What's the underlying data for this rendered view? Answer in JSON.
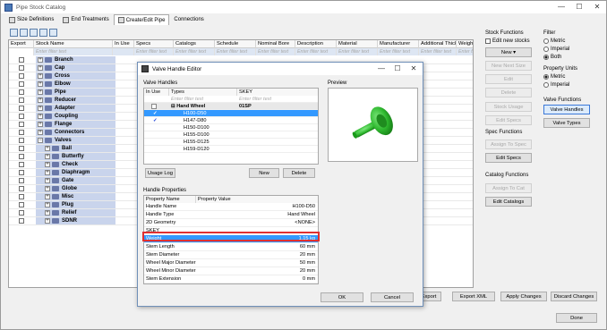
{
  "window": {
    "title": "Pipe Stock Catalog",
    "minimize": "—",
    "maximize": "☐",
    "close": "✕"
  },
  "tabs": [
    {
      "label": "Size Definitions"
    },
    {
      "label": "End Treatments"
    },
    {
      "label": "Create/Edit Pipe"
    },
    {
      "label": "Connections"
    }
  ],
  "grid": {
    "headers": [
      "Export",
      "Stock Name",
      "In Use",
      "Specs",
      "Catalogs",
      "Schedule",
      "Nominal Bore",
      "Description",
      "Material",
      "Manufacturer",
      "Additional Thickness",
      "Weight"
    ],
    "filter_placeholder": "Enter filter text",
    "rows": [
      {
        "label": "Branch"
      },
      {
        "label": "Cap"
      },
      {
        "label": "Cross"
      },
      {
        "label": "Elbow"
      },
      {
        "label": "Pipe"
      },
      {
        "label": "Reducer"
      },
      {
        "label": "Adapter"
      },
      {
        "label": "Coupling"
      },
      {
        "label": "Flange"
      },
      {
        "label": "Connectors"
      },
      {
        "label": "Valves"
      },
      {
        "label": "Ball"
      },
      {
        "label": "Butterfly"
      },
      {
        "label": "Check"
      },
      {
        "label": "Diaphragm"
      },
      {
        "label": "Gate"
      },
      {
        "label": "Globe"
      },
      {
        "label": "Misc"
      },
      {
        "label": "Plug"
      },
      {
        "label": "Relief"
      },
      {
        "label": "SDNR"
      }
    ]
  },
  "stock_functions": {
    "title": "Stock Functions",
    "edit_new_label": "Edit new stocks",
    "new_label": "New",
    "new_arrow": "▾",
    "buttons": [
      "New Next Size",
      "Edit",
      "Delete",
      "Stock Usage",
      "Edit Specs"
    ]
  },
  "spec_functions": {
    "title": "Spec Functions",
    "buttons": [
      "Assign To Spec",
      "Edit Specs"
    ]
  },
  "catalog_functions": {
    "title": "Catalog Functions",
    "buttons": [
      "Assign To Cat",
      "Edit Catalogs"
    ]
  },
  "filter": {
    "title": "Filter",
    "options": [
      "Metric",
      "Imperial",
      "Both"
    ],
    "selected": "Both"
  },
  "property_units": {
    "title": "Property Units",
    "options": [
      "Metric",
      "Imperial"
    ],
    "selected": "Metric"
  },
  "valve_functions": {
    "title": "Valve Functions",
    "buttons": [
      "Valve Handles",
      "Valve Types"
    ]
  },
  "bottom_buttons": [
    "Export",
    "Export XML",
    "Apply Changes",
    "Discard Changes",
    "Done"
  ],
  "dialog": {
    "title": "Valve Handle Editor",
    "valve_handles_title": "Valve Handles",
    "handles_headers": [
      "In Use",
      "Types",
      "SKEY"
    ],
    "filter_placeholder": "Enter filter text",
    "group": {
      "label": "Hand Wheel",
      "skey": "01SP"
    },
    "handles": [
      {
        "name": "H100-D50",
        "in_use": "✓"
      },
      {
        "name": "H147-D80",
        "in_use": "✓"
      },
      {
        "name": "H150-D100",
        "in_use": ""
      },
      {
        "name": "H155-D100",
        "in_use": ""
      },
      {
        "name": "H155-D125",
        "in_use": ""
      },
      {
        "name": "H159-D120",
        "in_use": ""
      }
    ],
    "usage_log_label": "Usage Log",
    "new_label": "New",
    "delete_label": "Delete",
    "preview_title": "Preview",
    "props_title": "Handle Properties",
    "props_headers": [
      "Property Name",
      "Property Value"
    ],
    "props": [
      {
        "name": "Handle Name",
        "value": "H100-D50"
      },
      {
        "name": "Handle Type",
        "value": "Hand Wheel"
      },
      {
        "name": "2D Geometry",
        "value": "<NONE>"
      },
      {
        "name": "SKEY",
        "value": ""
      },
      {
        "name": "Weight",
        "value": "1.15 kg"
      },
      {
        "name": "Stem Length",
        "value": "60 mm"
      },
      {
        "name": "Stem Diameter",
        "value": "20 mm"
      },
      {
        "name": "Wheel Major Diameter",
        "value": "50 mm"
      },
      {
        "name": "Wheel Minor Diameter",
        "value": "20 mm"
      },
      {
        "name": "Stem Extension",
        "value": "0 mm"
      }
    ],
    "ok_label": "OK",
    "cancel_label": "Cancel"
  },
  "colors": {
    "highlight": "#3399ff",
    "annotation": "#e03030",
    "preview_green": "#2fb82f"
  }
}
